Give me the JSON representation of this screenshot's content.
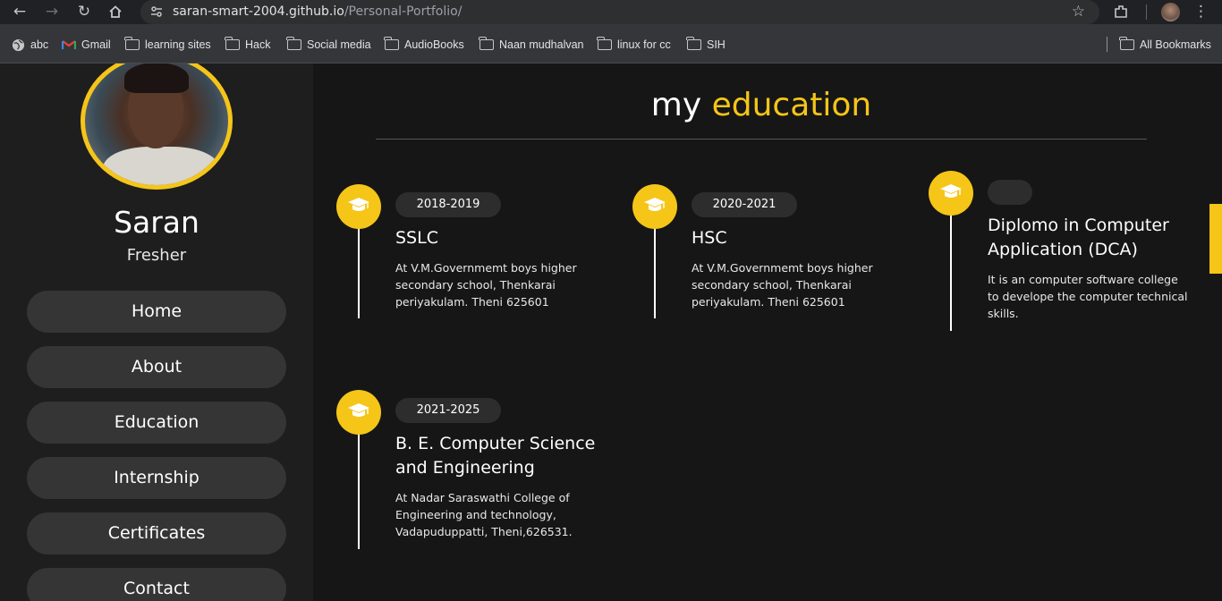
{
  "browser": {
    "url_host": "saran-smart-2004.github.io",
    "url_path": "/Personal-Portfolio/",
    "bookmarks": [
      {
        "label": "abc",
        "icon": "globe-icon"
      },
      {
        "label": "Gmail",
        "icon": "gmail-icon"
      },
      {
        "label": "learning sites",
        "icon": "folder-icon"
      },
      {
        "label": "Hack",
        "icon": "folder-icon"
      },
      {
        "label": "Social media",
        "icon": "folder-icon"
      },
      {
        "label": "AudioBooks",
        "icon": "folder-icon"
      },
      {
        "label": "Naan mudhalvan",
        "icon": "folder-icon"
      },
      {
        "label": "linux for cc",
        "icon": "folder-icon"
      },
      {
        "label": "SIH",
        "icon": "folder-icon"
      }
    ],
    "all_bookmarks": "All Bookmarks"
  },
  "profile": {
    "name": "Saran",
    "role": "Fresher"
  },
  "menu": [
    "Home",
    "About",
    "Education",
    "Internship",
    "Certificates",
    "Contact"
  ],
  "section": {
    "title_plain": "my",
    "title_highlight": "education"
  },
  "education": [
    {
      "date": "2018-2019",
      "title": "SSLC",
      "text": "At V.M.Governmemt boys higher secondary school, Thenkarai periyakulam. Theni 625601"
    },
    {
      "date": "2020-2021",
      "title": "HSC",
      "text": "At V.M.Governmemt boys higher secondary school, Thenkarai periyakulam. Theni 625601"
    },
    {
      "date": "",
      "title": "Diplomo in Computer Application (DCA)",
      "text": "It is an computer software college to develope the computer technical skills."
    },
    {
      "date": "2021-2025",
      "title": "B. E. Computer Science and Engineering",
      "text": "At Nadar Saraswathi College of Engineering and technology, Vadapuduppatti, Theni,626531."
    }
  ],
  "colors": {
    "accent": "#f5c518",
    "sidebar_bg": "#1e1e1e",
    "main_bg": "#161616",
    "button_bg": "#353535"
  }
}
